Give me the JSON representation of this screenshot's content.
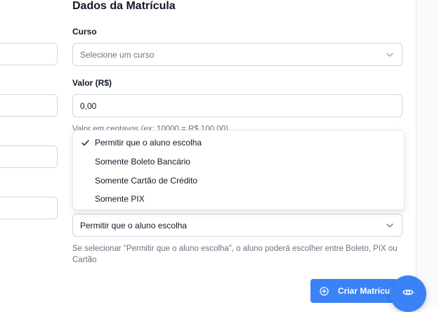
{
  "section": {
    "title": "Dados da Matrícula"
  },
  "course": {
    "label": "Curso",
    "placeholder": "Selecione um curso"
  },
  "value": {
    "label": "Valor (R$)",
    "input_value": "0,00",
    "hint": "Valor em centavos (ex: 10000 = R$ 100,00)"
  },
  "payment": {
    "options": [
      "Permitir que o aluno escolha",
      "Somente Boleto Bancário",
      "Somente Cartão de Crédito",
      "Somente PIX"
    ],
    "selected": "Permitir que o aluno escolha",
    "hint_line1": "Se selecionar \"Permitir que o aluno escolha\", o aluno poderá escolher entre Boleto, PIX ou",
    "hint_line2": "Cartão"
  },
  "actions": {
    "create_label": "Criar Matrícul"
  },
  "icons": {
    "chevron": "chevron-down-icon",
    "check": "check-icon",
    "plus": "plus-circle-icon",
    "eye": "eye-icon"
  },
  "colors": {
    "accent": "#3b82f6",
    "border": "#d1d5db",
    "muted_text": "#6b7280"
  }
}
